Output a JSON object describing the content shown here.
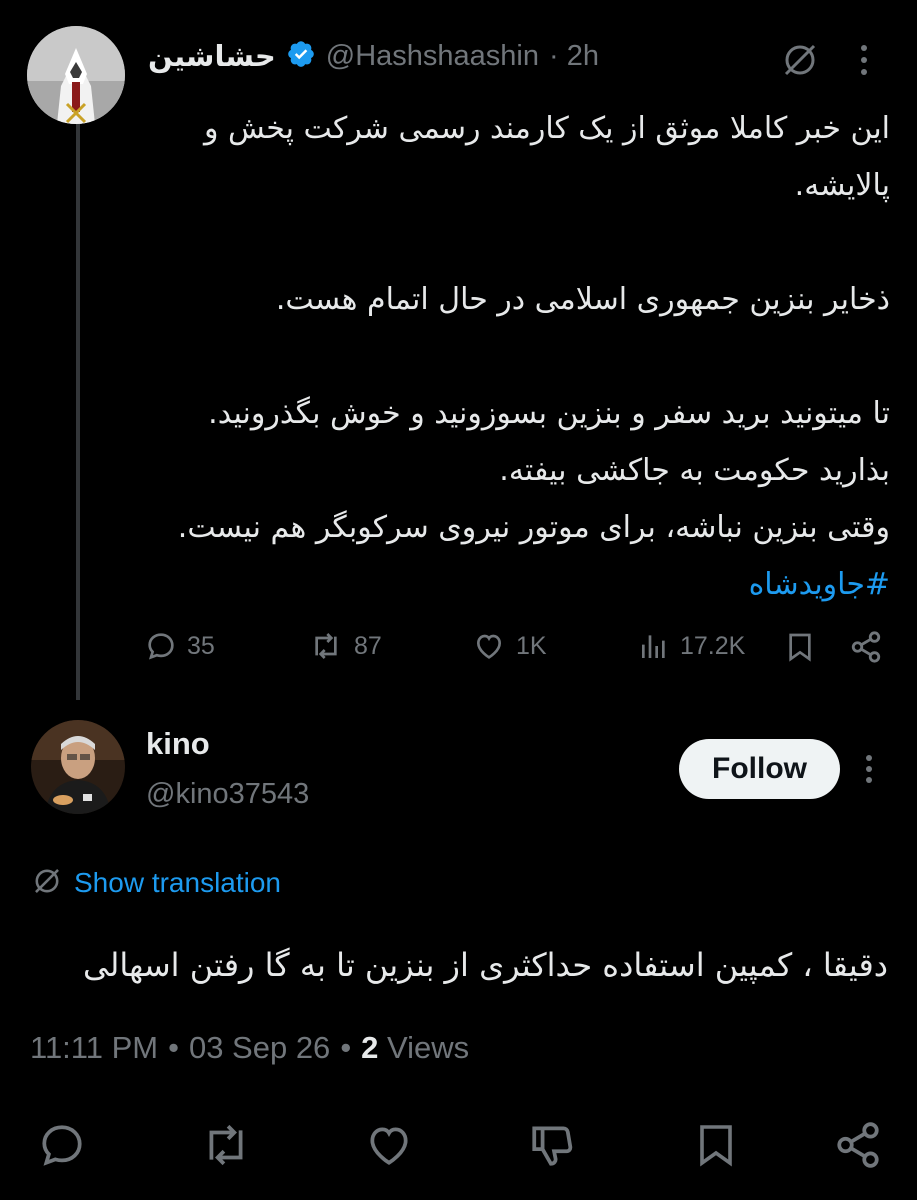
{
  "original_tweet": {
    "display_name": "حشاشین",
    "handle": "@Hashshaashin",
    "time": "· 2h",
    "verified": true,
    "lines": [
      "این خبر کاملا موثق از یک کارمند رسمی شرکت پخش و",
      "پالایشه.",
      "",
      "ذخایر بنزین جمهوری اسلامی در حال اتمام هست.",
      "",
      "تا میتونید برید سفر و بنزین بسوزونید و خوش بگذرونید.",
      "بذارید حکومت به جاکشی بیفته.",
      "وقتی بنزین نباشه، برای موتور نیروی سرکوبگر هم نیست."
    ],
    "hashtag": "#جاویدشاه",
    "stats": {
      "replies": "35",
      "reposts": "87",
      "likes": "1K",
      "views": "17.2K"
    }
  },
  "reply": {
    "display_name": "kino",
    "handle": "@kino37543",
    "follow_label": "Follow",
    "show_translation": "Show translation",
    "text": "دقیقا ، کمپین استفاده حداکثری از بنزین تا به گا رفتن اسهالی",
    "timestamp": "11:11 PM",
    "separator": "•",
    "date": "03 Sep 26",
    "views_count": "2",
    "views_label": "Views"
  },
  "icons": {
    "verified": "verified-badge-icon",
    "grok": "grok-icon",
    "more": "more-vertical-icon",
    "reply": "reply-icon",
    "repost": "repost-icon",
    "like": "like-icon",
    "views": "views-chart-icon",
    "bookmark": "bookmark-icon",
    "share": "share-icon",
    "translate": "translate-icon",
    "dislike": "dislike-icon"
  },
  "colors": {
    "background": "#000000",
    "text": "#e7e9ea",
    "muted": "#71767b",
    "accent": "#1d9bf0",
    "button_bg": "#eff3f4"
  }
}
